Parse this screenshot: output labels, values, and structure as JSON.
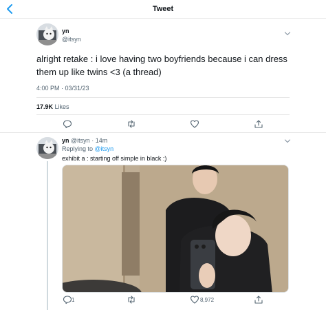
{
  "header": {
    "title": "Tweet",
    "back_icon": "chevron-left-icon"
  },
  "main_tweet": {
    "author_name": "yn",
    "author_handle": "@itsyn",
    "text": "alright retake : i love having two boyfriends because i can dress them up like twins <3 (a thread)",
    "timestamp": "4:00 PM · 03/31/23",
    "likes_count": "17.9K",
    "likes_label": "Likes"
  },
  "reply_tweet": {
    "author_name": "yn",
    "author_handle": "@itsyn",
    "time": "· 14m",
    "replying_to_label": "Replying to",
    "replying_to_handle": "@itsyn",
    "text": "exhibit a : starting off simple in black :)",
    "reply_count": "1",
    "like_count": "8,972"
  },
  "colors": {
    "accent": "#1d9bf0",
    "text": "#0f1419",
    "secondary": "#536471",
    "divider": "#e6e6e6"
  }
}
